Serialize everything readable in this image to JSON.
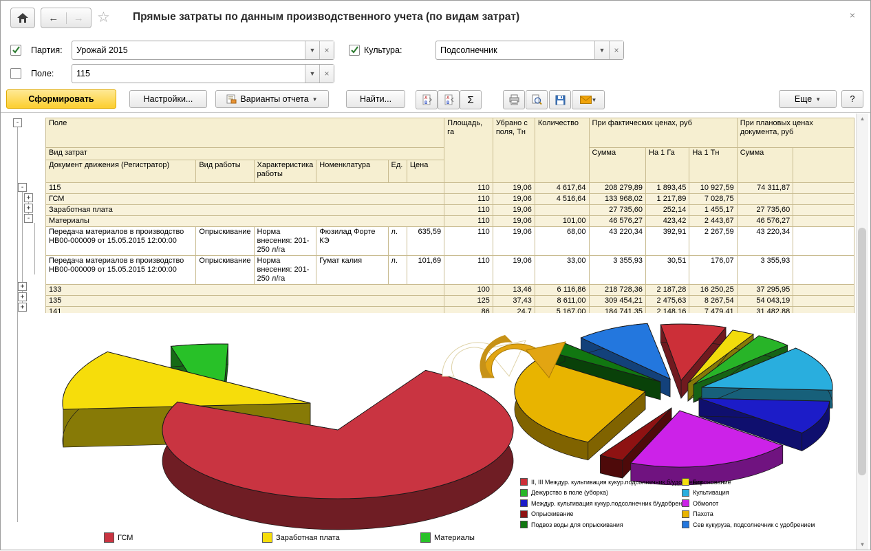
{
  "window": {
    "title": "Прямые затраты по данным производственного учета (по видам затрат)",
    "close_label": "×"
  },
  "filters": {
    "partia": {
      "checked": true,
      "label": "Партия:",
      "value": "Урожай 2015"
    },
    "kultura": {
      "checked": true,
      "label": "Культура:",
      "value": "Подсолнечник"
    },
    "pole": {
      "checked": false,
      "label": "Поле:",
      "value": "115"
    }
  },
  "toolbar": {
    "generate": "Сформировать",
    "settings": "Настройки...",
    "variants": "Варианты отчета",
    "find": "Найти...",
    "sum_icon_label": "Σ",
    "more": "Еще",
    "help": "?"
  },
  "table": {
    "header": {
      "field": "Поле",
      "cost_type": "Вид затрат",
      "doc": "Документ движения (Регистратор)",
      "work_type": "Вид работы",
      "work_char": "Характеристика работы",
      "nomenclature": "Номенклатура",
      "unit": "Ед.",
      "price": "Цена",
      "area": "Площадь, га",
      "harvested": "Убрано с поля, Тн",
      "quantity": "Количество",
      "fact": "При фактических ценах, руб",
      "sum": "Сумма",
      "per_ha": "На 1 Га",
      "per_tn": "На 1 Тн",
      "plan": "При плановых ценах документа, руб",
      "plan_sum": "Сумма"
    },
    "rows": [
      {
        "type": "group",
        "level": 1,
        "expander": "minus",
        "label": "115",
        "values": [
          "110",
          "19,06",
          "4 617,64",
          "208 279,89",
          "1 893,45",
          "10 927,59",
          "74 311,87"
        ]
      },
      {
        "type": "group",
        "level": 2,
        "expander": "plus",
        "label": "ГСМ",
        "values": [
          "110",
          "19,06",
          "4 516,64",
          "133 968,02",
          "1 217,89",
          "7 028,75",
          ""
        ]
      },
      {
        "type": "group",
        "level": 2,
        "expander": "plus",
        "label": "Заработная плата",
        "values": [
          "110",
          "19,06",
          "",
          "27 735,60",
          "252,14",
          "1 455,17",
          "27 735,60"
        ]
      },
      {
        "type": "group",
        "level": 2,
        "expander": "minus",
        "label": "Материалы",
        "values": [
          "110",
          "19,06",
          "101,00",
          "46 576,27",
          "423,42",
          "2 443,67",
          "46 576,27"
        ]
      },
      {
        "type": "detail",
        "doc": "Передача материалов в производство НВ00-000009 от 15.05.2015 12:00:00",
        "work": "Опрыскивание",
        "characteristic": "Норма внесения: 201-250 л/га",
        "nomenclature": "Фюзилад Форте КЭ",
        "unit": "л.",
        "price": "635,59",
        "values": [
          "110",
          "19,06",
          "68,00",
          "43 220,34",
          "392,91",
          "2 267,59",
          "43 220,34"
        ]
      },
      {
        "type": "detail",
        "doc": "Передача материалов в производство НВ00-000009 от 15.05.2015 12:00:00",
        "work": "Опрыскивание",
        "characteristic": "Норма внесения: 201-250 л/га",
        "nomenclature": "Гумат калия",
        "unit": "л.",
        "price": "101,69",
        "values": [
          "110",
          "19,06",
          "33,00",
          "3 355,93",
          "30,51",
          "176,07",
          "3 355,93"
        ]
      },
      {
        "type": "group",
        "level": 1,
        "expander": "plus",
        "label": "133",
        "values": [
          "100",
          "13,46",
          "6 116,86",
          "218 728,36",
          "2 187,28",
          "16 250,25",
          "37 295,95"
        ]
      },
      {
        "type": "group",
        "level": 1,
        "expander": "plus",
        "label": "135",
        "values": [
          "125",
          "37,43",
          "8 611,00",
          "309 454,21",
          "2 475,63",
          "8 267,54",
          "54 043,19"
        ]
      },
      {
        "type": "group",
        "level": 1,
        "expander": "plus",
        "label": "141",
        "values": [
          "86",
          "24,7",
          "5 167,00",
          "184 741,35",
          "2 148,16",
          "7 479,41",
          "31 482,88"
        ]
      }
    ]
  },
  "chart_data": [
    {
      "type": "pie",
      "style": "3d-exploded",
      "title": "",
      "legend_position": "bottom",
      "slices": [
        {
          "label": "ГСМ",
          "color": "#c93441",
          "pct_est": 76
        },
        {
          "label": "Заработная плата",
          "color": "#f6dd0b",
          "pct_est": 16
        },
        {
          "label": "Материалы",
          "color": "#28c128",
          "pct_est": 8
        }
      ]
    },
    {
      "type": "pie",
      "style": "3d-exploded",
      "title": "",
      "legend_position": "bottom-two-columns",
      "slices": [
        {
          "label": "II, III Междур. культивация кукур.подсолнечник б/удобрения",
          "color": "#cc2f38",
          "pct_est": 8
        },
        {
          "label": "Дежурство в поле (уборка)",
          "color": "#28b428",
          "pct_est": 4
        },
        {
          "label": "Междур. культивация кукур.подсолнечник б/удобрения",
          "color": "#1c1cc8",
          "pct_est": 10
        },
        {
          "label": "Опрыскивание",
          "color": "#8e1212",
          "pct_est": 3
        },
        {
          "label": "Подвоз воды для опрыскивания",
          "color": "#117711",
          "pct_est": 3
        },
        {
          "label": "Боронование",
          "color": "#f2dc0c",
          "pct_est": 3
        },
        {
          "label": "Культивация",
          "color": "#29aede",
          "pct_est": 13
        },
        {
          "label": "Обмолот",
          "color": "#cc22e8",
          "pct_est": 21
        },
        {
          "label": "Пахота",
          "color": "#e8b400",
          "pct_est": 26
        },
        {
          "label": "Сев кукуруза, подсолнечник с удобрением",
          "color": "#2377de",
          "pct_est": 9
        }
      ]
    }
  ]
}
